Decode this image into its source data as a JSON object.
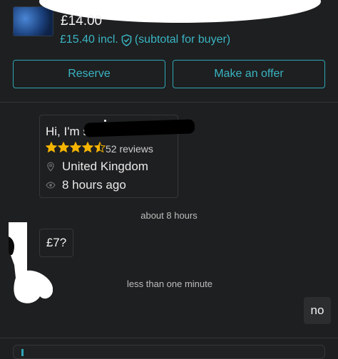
{
  "listing": {
    "price": "£14.00",
    "price_incl": "£15.40 incl.",
    "price_note": "(subtotal for buyer)"
  },
  "actions": {
    "reserve_label": "Reserve",
    "offer_label": "Make an offer"
  },
  "profile": {
    "greeting": "Hi, I'm s",
    "rating": 4.5,
    "reviews": "52 reviews",
    "location": "United Kingdom",
    "last_seen": "8 hours ago"
  },
  "messages": [
    {
      "timestamp": "about 8 hours",
      "text": "£7?",
      "side": "left"
    },
    {
      "timestamp": "less than one minute",
      "text": "no",
      "side": "right"
    }
  ],
  "colors": {
    "accent": "#2ea6b6",
    "star": "#f4b400",
    "background": "#1e1f20"
  },
  "icons": [
    "item-thumbnail",
    "shield-check-icon",
    "star-icon",
    "location-pin-icon",
    "eye-icon"
  ]
}
